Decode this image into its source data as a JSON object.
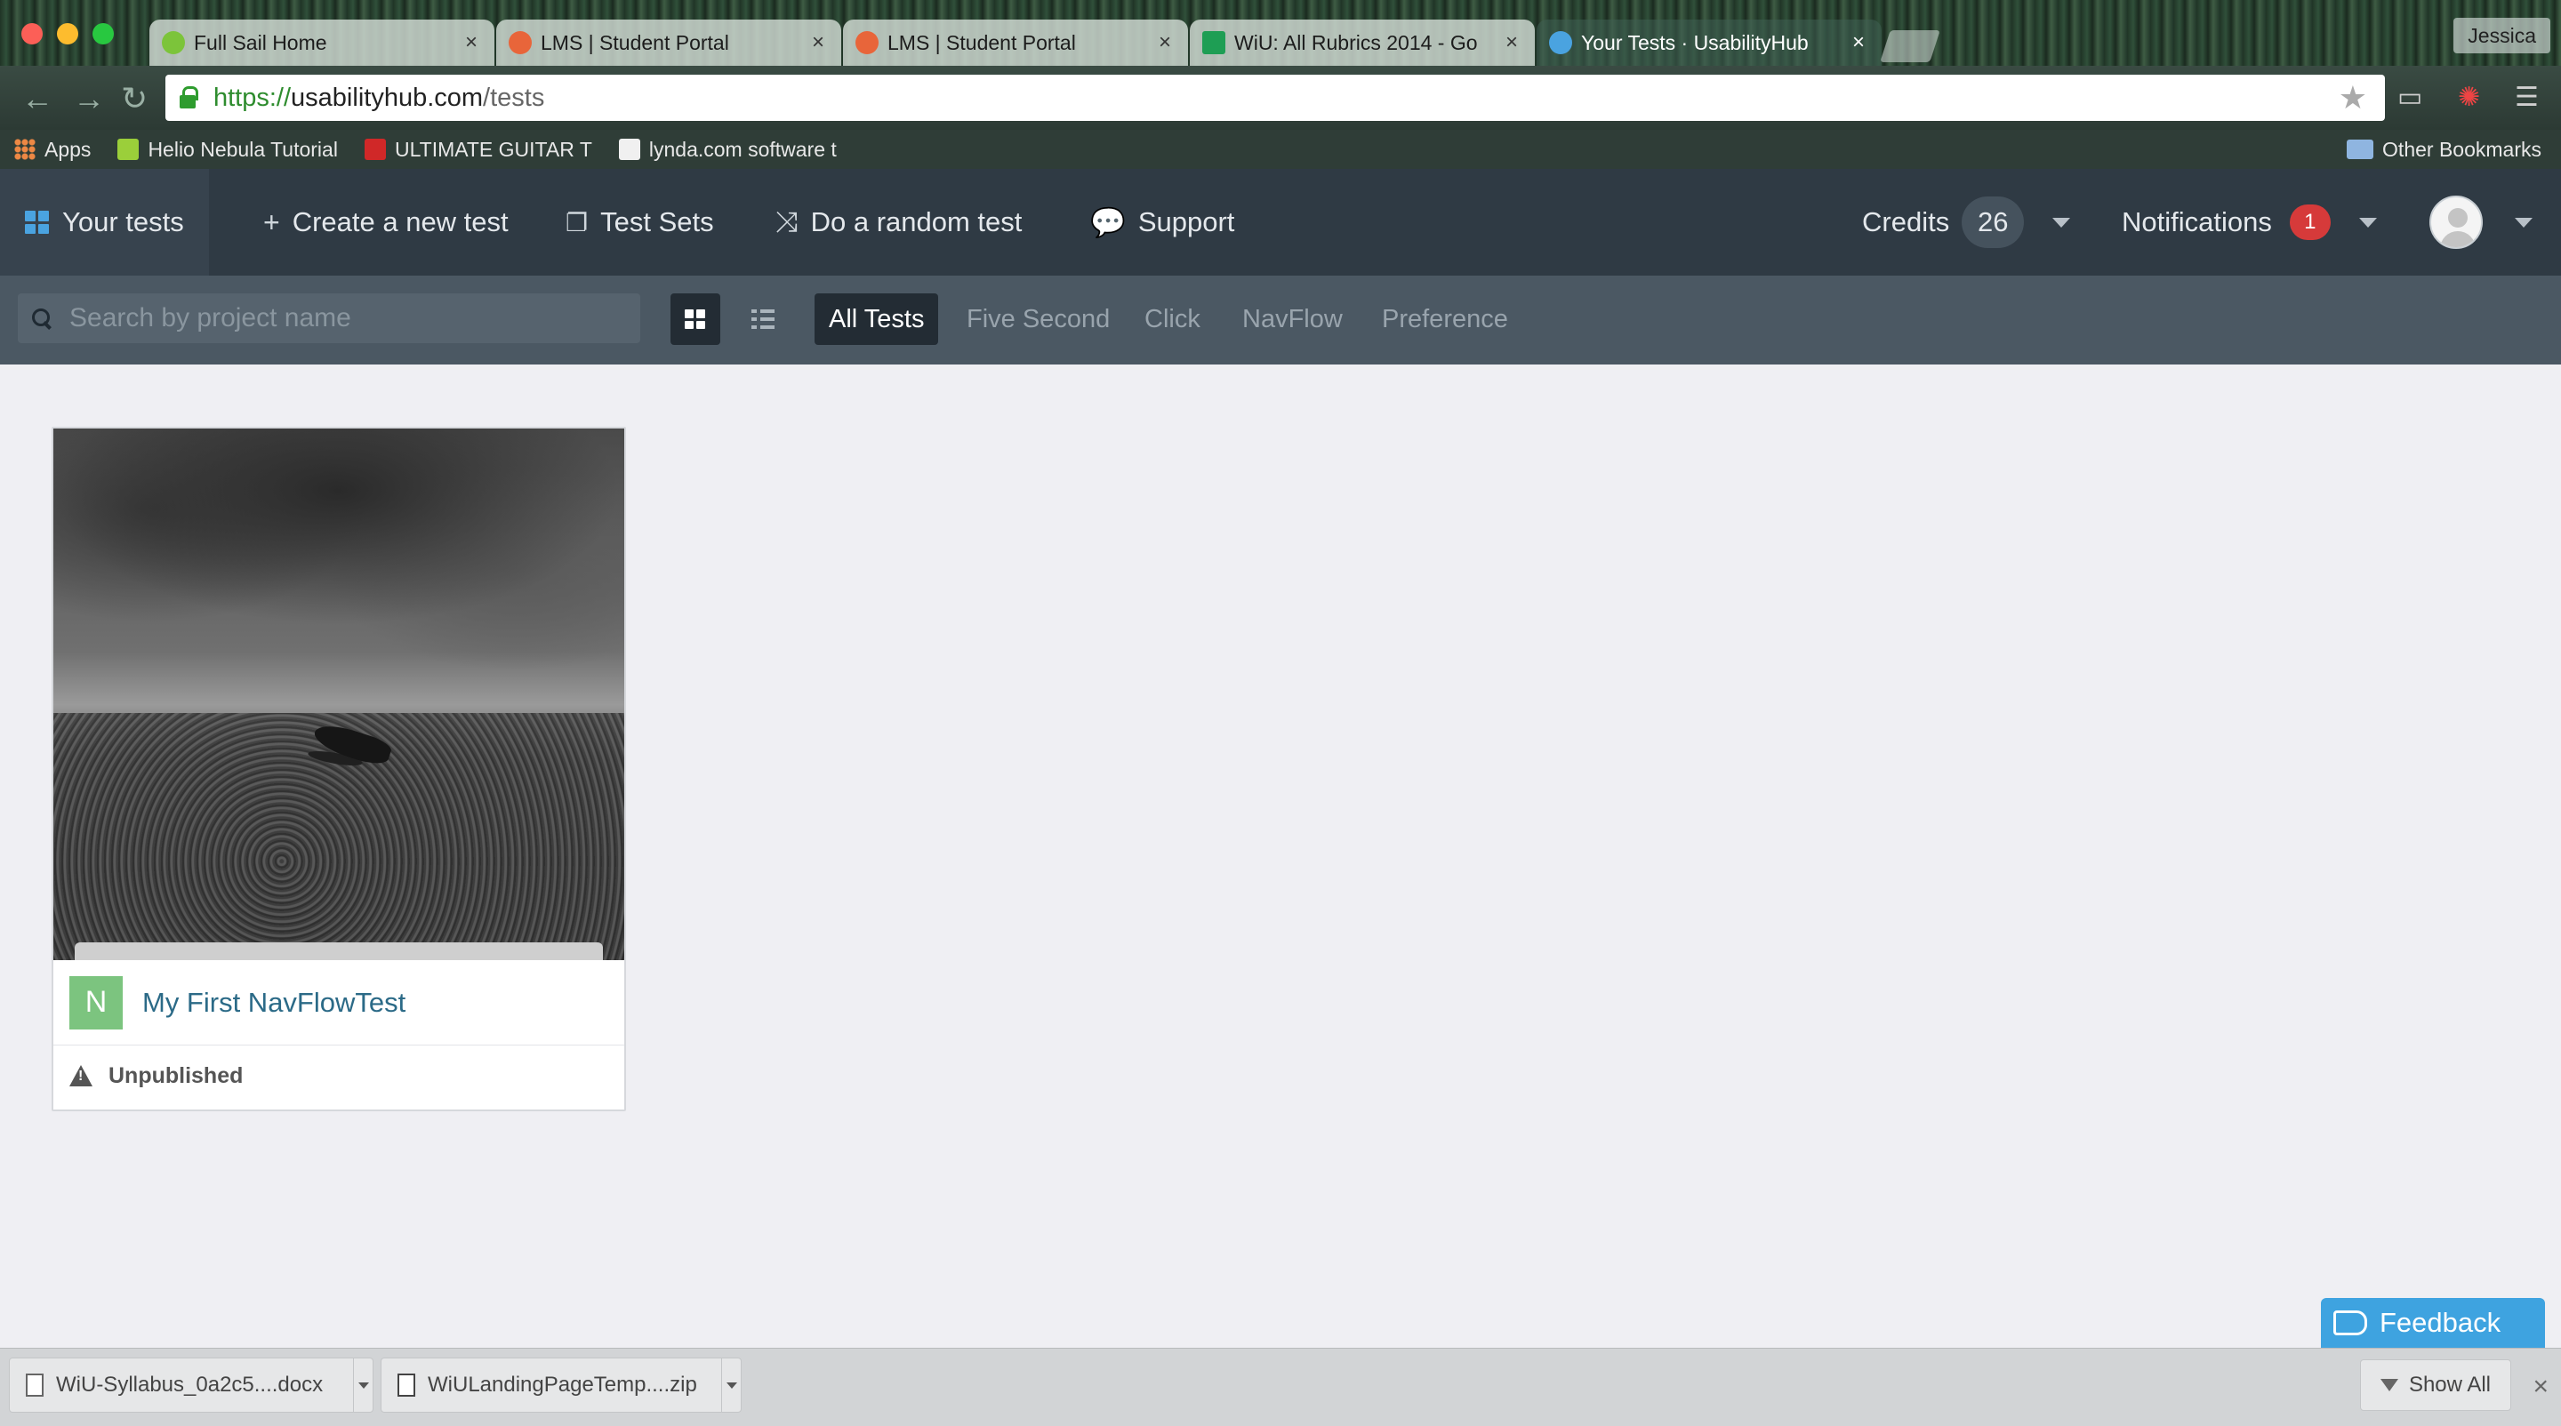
{
  "browser": {
    "tabs": [
      {
        "title": "Full Sail Home",
        "favicon_color": "#7cc43a"
      },
      {
        "title": "LMS | Student Portal",
        "favicon_color": "#e8653a"
      },
      {
        "title": "LMS | Student Portal",
        "favicon_color": "#e8653a"
      },
      {
        "title": "WiU: All Rubrics 2014 - Go",
        "favicon_color": "#1e9e54"
      },
      {
        "title": "Your Tests · UsabilityHub",
        "favicon_color": "#4aa3e0"
      }
    ],
    "profile_name": "Jessica",
    "url": {
      "scheme": "https://",
      "host": "usabilityhub.com",
      "path": "/tests"
    },
    "bookmarks": [
      {
        "label": "Apps"
      },
      {
        "label": "Helio Nebula Tutorial"
      },
      {
        "label": "ULTIMATE GUITAR T"
      },
      {
        "label": "lynda.com software t"
      }
    ],
    "other_bookmarks": "Other Bookmarks"
  },
  "nav": {
    "your_tests": "Your tests",
    "create": "Create a new test",
    "test_sets": "Test Sets",
    "random": "Do a random test",
    "support": "Support",
    "credits_label": "Credits",
    "credits_value": "26",
    "notifications_label": "Notifications",
    "notifications_count": "1"
  },
  "filters": {
    "search_placeholder": "Search by project name",
    "tabs": [
      "All Tests",
      "Five Second",
      "Click",
      "NavFlow",
      "Preference"
    ],
    "active": "All Tests"
  },
  "tests": [
    {
      "type_letter": "N",
      "title": "My First NavFlowTest",
      "status": "Unpublished"
    }
  ],
  "feedback_label": "Feedback",
  "downloads": {
    "items": [
      "WiU-Syllabus_0a2c5....docx",
      "WiULandingPageTemp....zip"
    ],
    "show_all": "Show All"
  },
  "colors": {
    "accent": "#4aa3e0",
    "nav_bg": "#2f3a44",
    "badge_red": "#d63a3a",
    "navflow_green": "#7cc47f"
  }
}
